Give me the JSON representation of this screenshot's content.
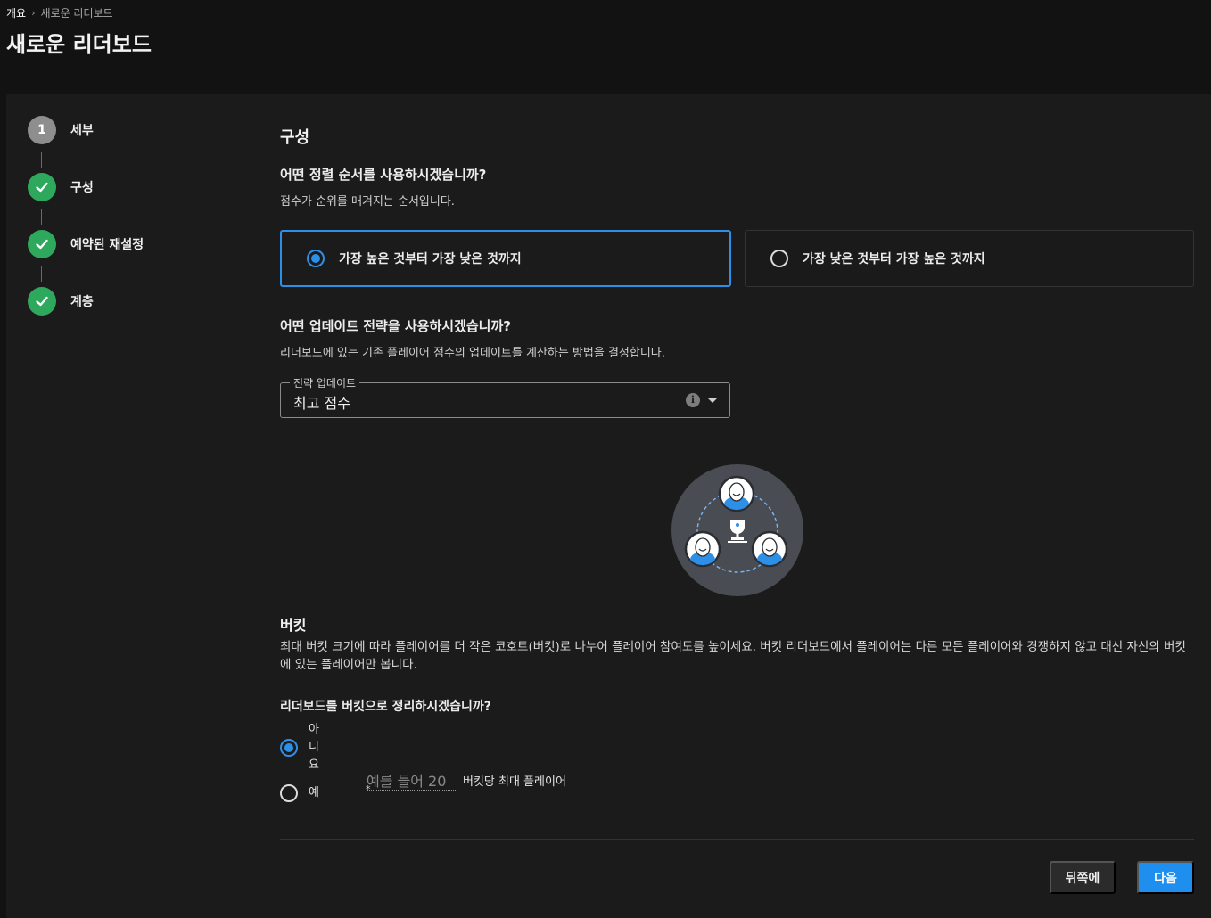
{
  "breadcrumb": {
    "root": "개요",
    "separator": "›",
    "current": "새로운 리더보드"
  },
  "page_title": "새로운 리더보드",
  "steps": [
    {
      "number": "1",
      "label": "세부",
      "state": "current"
    },
    {
      "label": "구성",
      "state": "done"
    },
    {
      "label": "예약된 재설정",
      "state": "done"
    },
    {
      "label": "계층",
      "state": "done"
    }
  ],
  "config": {
    "section_title": "구성",
    "sort": {
      "question": "어떤 정렬 순서를 사용하시겠습니까?",
      "description": "점수가 순위를 매겨지는 순서입니다.",
      "options": [
        {
          "label": "가장 높은 것부터 가장 낮은 것까지",
          "selected": true
        },
        {
          "label": "가장 낮은 것부터 가장 높은 것까지",
          "selected": false
        }
      ]
    },
    "update": {
      "question": "어떤 업데이트 전략을 사용하시겠습니까?",
      "description": "리더보드에 있는 기존 플레이어 점수의 업데이트를 계산하는 방법을 결정합니다.",
      "field_label": "전략 업데이트",
      "value": "최고 점수",
      "info_icon": "i"
    },
    "bucket": {
      "title": "버킷",
      "description": "최대 버킷 크기에 따라 플레이어를 더 작은 코호트(버킷)로 나누어 플레이어 참여도를 높이세요. 버킷 리더보드에서 플레이어는 다른 모든 플레이어와 경쟁하지 않고 대신 자신의 버킷에 있는 플레이어만 봅니다.",
      "question": "리더보드를 버킷으로 정리하시겠습니까?",
      "option_no": "아니요",
      "option_yes": "예",
      "selected": "no",
      "input_placeholder": "예를 들어 20",
      "input_required_mark": "*",
      "input_suffix": "버킷당 최대 플레이어"
    }
  },
  "buttons": {
    "back": "뒤쪽에",
    "next": "다음"
  },
  "colors": {
    "accent": "#2e8fe6",
    "success": "#2ea85c",
    "background": "#121212",
    "panel": "#1b1b1b"
  }
}
